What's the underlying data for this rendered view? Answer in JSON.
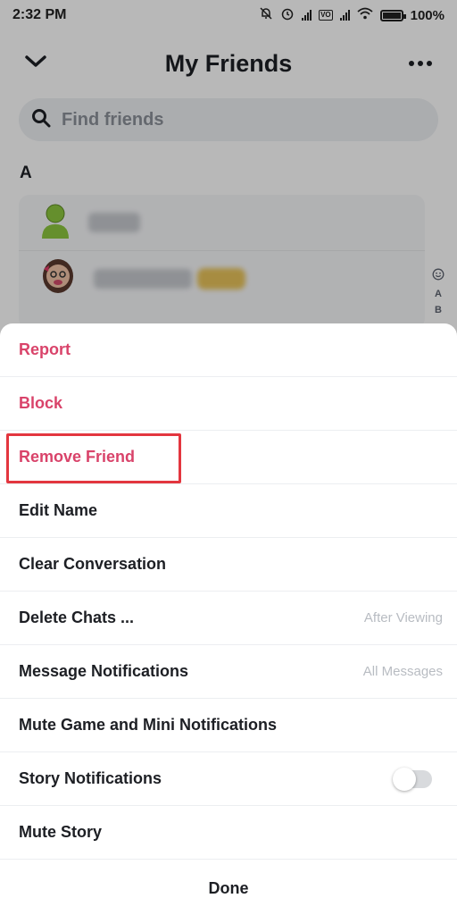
{
  "status_bar": {
    "time": "2:32 PM",
    "battery": "100%",
    "battery_level": 1.0
  },
  "header": {
    "title": "My Friends"
  },
  "search": {
    "placeholder": "Find friends"
  },
  "section": {
    "letter": "A"
  },
  "index_bar": [
    "A",
    "B"
  ],
  "menu": {
    "items": [
      {
        "label": "Report",
        "style": "danger"
      },
      {
        "label": "Block",
        "style": "danger"
      },
      {
        "label": "Remove Friend",
        "style": "danger",
        "highlighted": true
      },
      {
        "label": "Edit Name"
      },
      {
        "label": "Clear Conversation"
      },
      {
        "label": "Delete Chats ...",
        "value": "After Viewing"
      },
      {
        "label": "Message Notifications",
        "value": "All Messages"
      },
      {
        "label": "Mute Game and Mini Notifications"
      },
      {
        "label": "Story Notifications",
        "toggle": false
      },
      {
        "label": "Mute Story"
      }
    ],
    "done_label": "Done"
  },
  "colors": {
    "danger": "#d9436a",
    "highlight_box": "#e3363f",
    "text": "#1d1f24"
  }
}
